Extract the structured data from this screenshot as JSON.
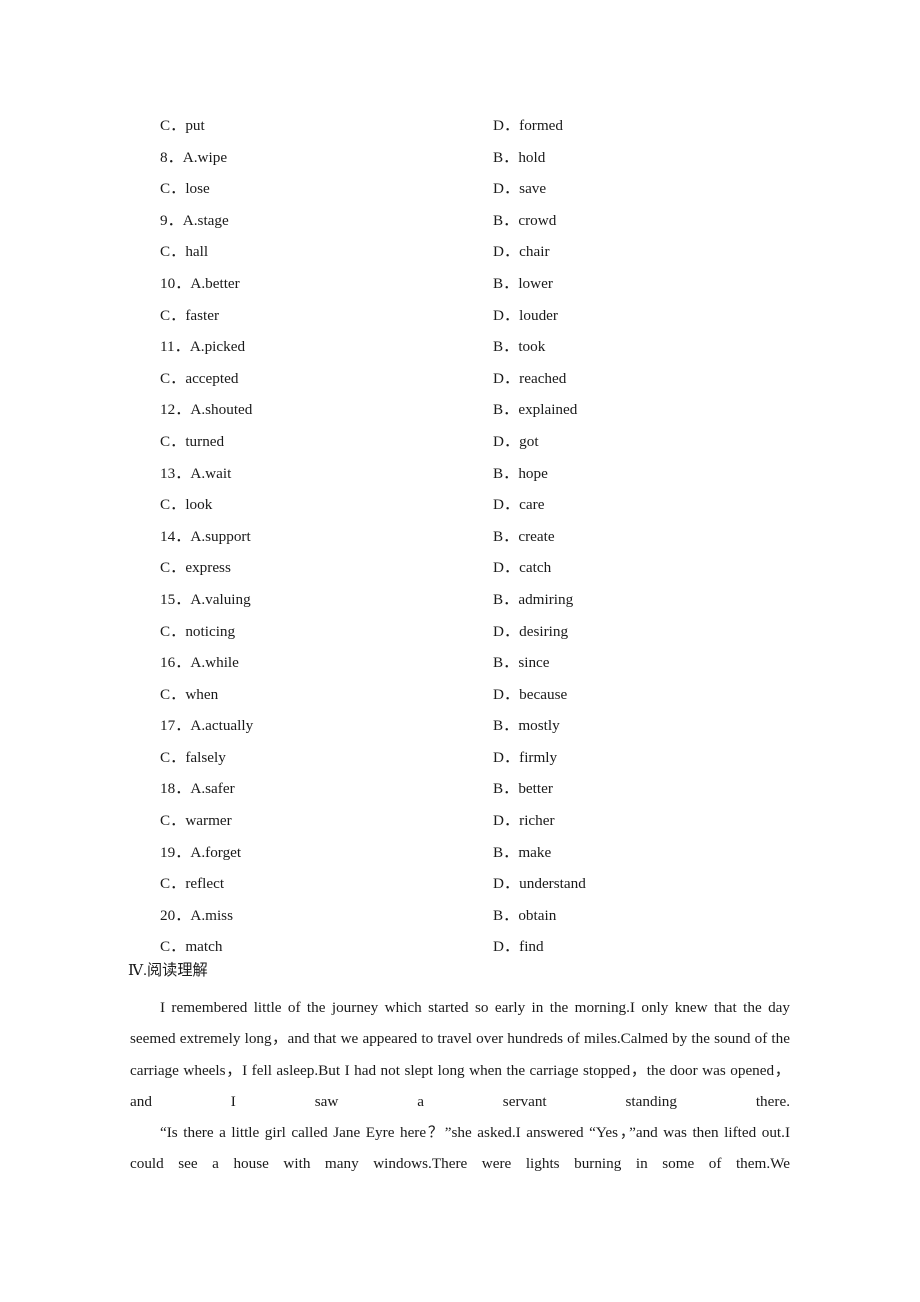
{
  "document": {
    "page_background": "#ffffff",
    "text_color": "#1a1a1a"
  },
  "options": {
    "rows": [
      {
        "left_key": "C．",
        "left_text": "put",
        "right_key": "D．",
        "right_text": "formed"
      },
      {
        "left_key": "8．",
        "left_text": "A.wipe",
        "right_key": "B．",
        "right_text": "hold"
      },
      {
        "left_key": "C．",
        "left_text": "lose",
        "right_key": "D．",
        "right_text": "save"
      },
      {
        "left_key": "9．",
        "left_text": "A.stage",
        "right_key": "B．",
        "right_text": "crowd"
      },
      {
        "left_key": "C．",
        "left_text": "hall",
        "right_key": "D．",
        "right_text": "chair"
      },
      {
        "left_key": "10．",
        "left_text": "A.better",
        "right_key": "B．",
        "right_text": "lower"
      },
      {
        "left_key": "C．",
        "left_text": "faster",
        "right_key": "D．",
        "right_text": "louder"
      },
      {
        "left_key": "11．",
        "left_text": "A.picked",
        "right_key": "B．",
        "right_text": "took"
      },
      {
        "left_key": "C．",
        "left_text": "accepted",
        "right_key": "D．",
        "right_text": "reached"
      },
      {
        "left_key": "12．",
        "left_text": "A.shouted",
        "right_key": "B．",
        "right_text": "explained"
      },
      {
        "left_key": "C．",
        "left_text": "turned",
        "right_key": "D．",
        "right_text": "got"
      },
      {
        "left_key": "13．",
        "left_text": "A.wait",
        "right_key": "B．",
        "right_text": "hope"
      },
      {
        "left_key": "C．",
        "left_text": "look",
        "right_key": "D．",
        "right_text": "care"
      },
      {
        "left_key": "14．",
        "left_text": "A.support",
        "right_key": "B．",
        "right_text": "create"
      },
      {
        "left_key": "C．",
        "left_text": "express",
        "right_key": "D．",
        "right_text": "catch"
      },
      {
        "left_key": "15．",
        "left_text": "A.valuing",
        "right_key": "B．",
        "right_text": "admiring"
      },
      {
        "left_key": "C．",
        "left_text": "noticing",
        "right_key": "D．",
        "right_text": "desiring"
      },
      {
        "left_key": "16．",
        "left_text": "A.while",
        "right_key": "B．",
        "right_text": "since"
      },
      {
        "left_key": "C．",
        "left_text": "when",
        "right_key": "D．",
        "right_text": "because"
      },
      {
        "left_key": "17．",
        "left_text": "A.actually",
        "right_key": "B．",
        "right_text": "mostly"
      },
      {
        "left_key": "C．",
        "left_text": "falsely",
        "right_key": "D．",
        "right_text": "firmly"
      },
      {
        "left_key": "18．",
        "left_text": "A.safer",
        "right_key": "B．",
        "right_text": "better"
      },
      {
        "left_key": "C．",
        "left_text": "warmer",
        "right_key": "D．",
        "right_text": "richer"
      },
      {
        "left_key": "19．",
        "left_text": "A.forget",
        "right_key": "B．",
        "right_text": "make"
      },
      {
        "left_key": "C．",
        "left_text": "reflect",
        "right_key": "D．",
        "right_text": "understand"
      },
      {
        "left_key": "20．",
        "left_text": "A.miss",
        "right_key": "B．",
        "right_text": "obtain"
      },
      {
        "left_key": "C．",
        "left_text": "match",
        "right_key": "D．",
        "right_text": "find"
      }
    ]
  },
  "reading_section": {
    "heading": "Ⅳ.阅读理解",
    "paragraphs": [
      "I remembered little of the journey which started so early in the morning.I only knew that the day seemed extremely long，and that we appeared to travel over hundreds of miles.Calmed by the sound of the carriage wheels，I fell asleep.But I had not slept long when the carriage stopped，the door was opened，and I saw a servant standing there.",
      "“Is there a little girl called Jane Eyre here？”she asked.I answered “Yes，”and was then lifted out.I could see a house with    many windows.There were lights burning in some of them.We"
    ]
  }
}
